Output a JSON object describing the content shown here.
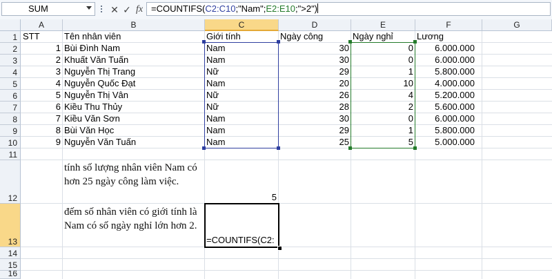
{
  "namebox": {
    "value": "SUM"
  },
  "formula_bar": {
    "p1": "=COUNTIFS(",
    "ref1": "C2:C10",
    "p2": ";\"Nam\";",
    "ref2": "E2:E10",
    "p3": ";\">2\")"
  },
  "icons": {
    "cancel": "cancel-icon",
    "enter": "check-icon",
    "fx": "fx-icon"
  },
  "fx_label": "fx",
  "columns": [
    "A",
    "B",
    "C",
    "D",
    "E",
    "F",
    "G"
  ],
  "rows": [
    "1",
    "2",
    "3",
    "4",
    "5",
    "6",
    "7",
    "8",
    "9",
    "10",
    "11",
    "12",
    "13",
    "14",
    "15",
    "16"
  ],
  "header_row": {
    "a": "STT",
    "b": "Tên nhân viên",
    "c": "Giới tính",
    "d": "Ngày công",
    "e": "Ngày nghỉ",
    "f": "Lương"
  },
  "employees": [
    {
      "stt": "1",
      "name": "Bùi Đình Nam",
      "gender": "Nam",
      "work_days": "30",
      "off_days": "0",
      "salary": "6.000.000"
    },
    {
      "stt": "2",
      "name": "Khuất Văn Tuấn",
      "gender": "Nam",
      "work_days": "30",
      "off_days": "0",
      "salary": "6.000.000"
    },
    {
      "stt": "3",
      "name": "Nguyễn Thị Trang",
      "gender": "Nữ",
      "work_days": "29",
      "off_days": "1",
      "salary": "5.800.000"
    },
    {
      "stt": "4",
      "name": "Nguyễn Quốc Đạt",
      "gender": "Nam",
      "work_days": "20",
      "off_days": "10",
      "salary": "4.000.000"
    },
    {
      "stt": "5",
      "name": "Nguyễn Thị Vân",
      "gender": "Nữ",
      "work_days": "26",
      "off_days": "4",
      "salary": "5.200.000"
    },
    {
      "stt": "6",
      "name": "Kiều Thu Thủy",
      "gender": "Nữ",
      "work_days": "28",
      "off_days": "2",
      "salary": "5.600.000"
    },
    {
      "stt": "7",
      "name": "Kiều Văn Sơn",
      "gender": "Nam",
      "work_days": "30",
      "off_days": "0",
      "salary": "6.000.000"
    },
    {
      "stt": "8",
      "name": "Bùi Văn Học",
      "gender": "Nam",
      "work_days": "29",
      "off_days": "1",
      "salary": "5.800.000"
    },
    {
      "stt": "9",
      "name": "Nguyễn Văn Tuấn",
      "gender": "Nam",
      "work_days": "25",
      "off_days": "5",
      "salary": "5.000.000"
    }
  ],
  "notes": {
    "q1": "tính số lượng nhân viên Nam có hơn 25 ngày công làm việc.",
    "q1_result": "5",
    "q2": "đếm số nhân viên có giới tính là Nam có số ngày nghỉ lớn hơn 2.",
    "q2_edit": "=COUNTIFS(C2:"
  },
  "colors": {
    "ref_c": "#2f3fa0",
    "ref_e": "#237a2a",
    "selected_header": "#f9d889"
  }
}
